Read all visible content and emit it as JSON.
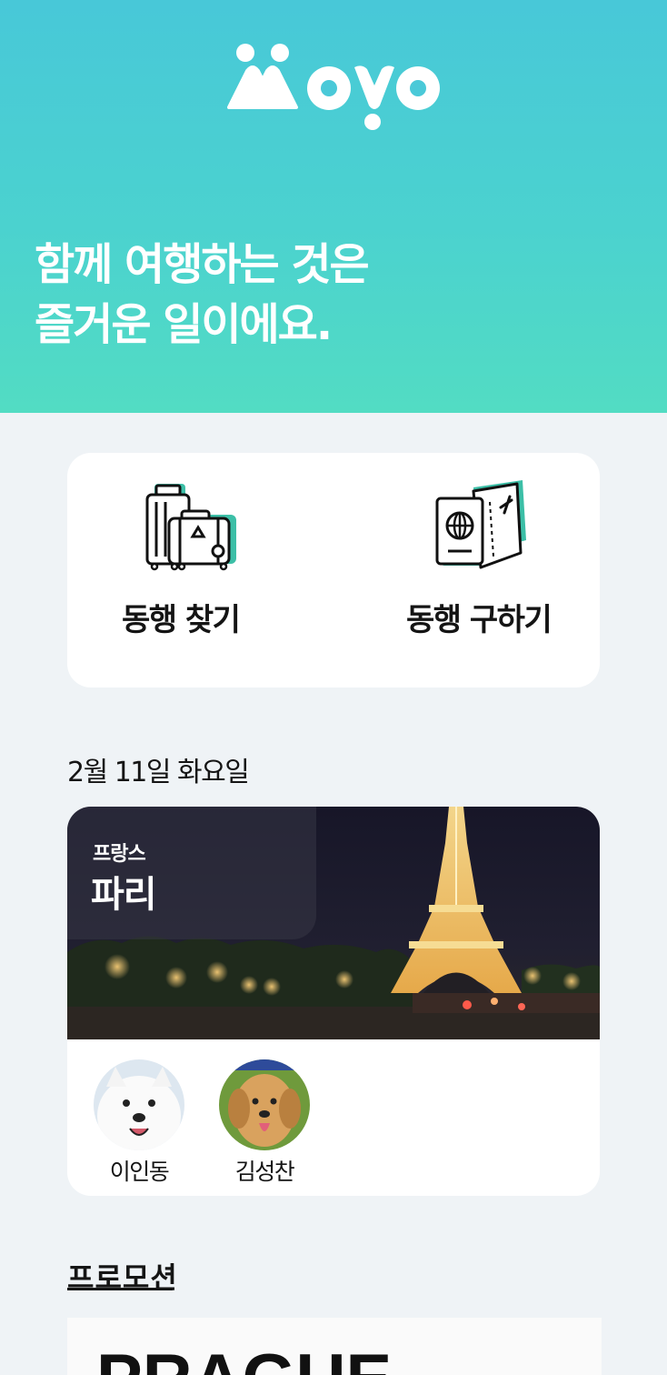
{
  "header": {
    "logo_text": "Moyo",
    "tagline_line1": "함께 여행하는 것은",
    "tagline_line2": "즐거운 일이에요."
  },
  "menu": {
    "find_label": "동행 찾기",
    "recruit_label": "동행 구하기"
  },
  "trip": {
    "date": "2월 11일 화요일",
    "country": "프랑스",
    "city": "파리",
    "companions": [
      {
        "name": "이인동"
      },
      {
        "name": "김성찬"
      }
    ]
  },
  "promotion": {
    "heading": "프로모션",
    "banner_text": "PRAGUE"
  },
  "colors": {
    "brand_teal": "#4bd2cf",
    "page_bg": "#eff3f6",
    "icon_accent": "#3cbfa7"
  },
  "icons": [
    "luggage-icon",
    "passport-ticket-icon"
  ]
}
